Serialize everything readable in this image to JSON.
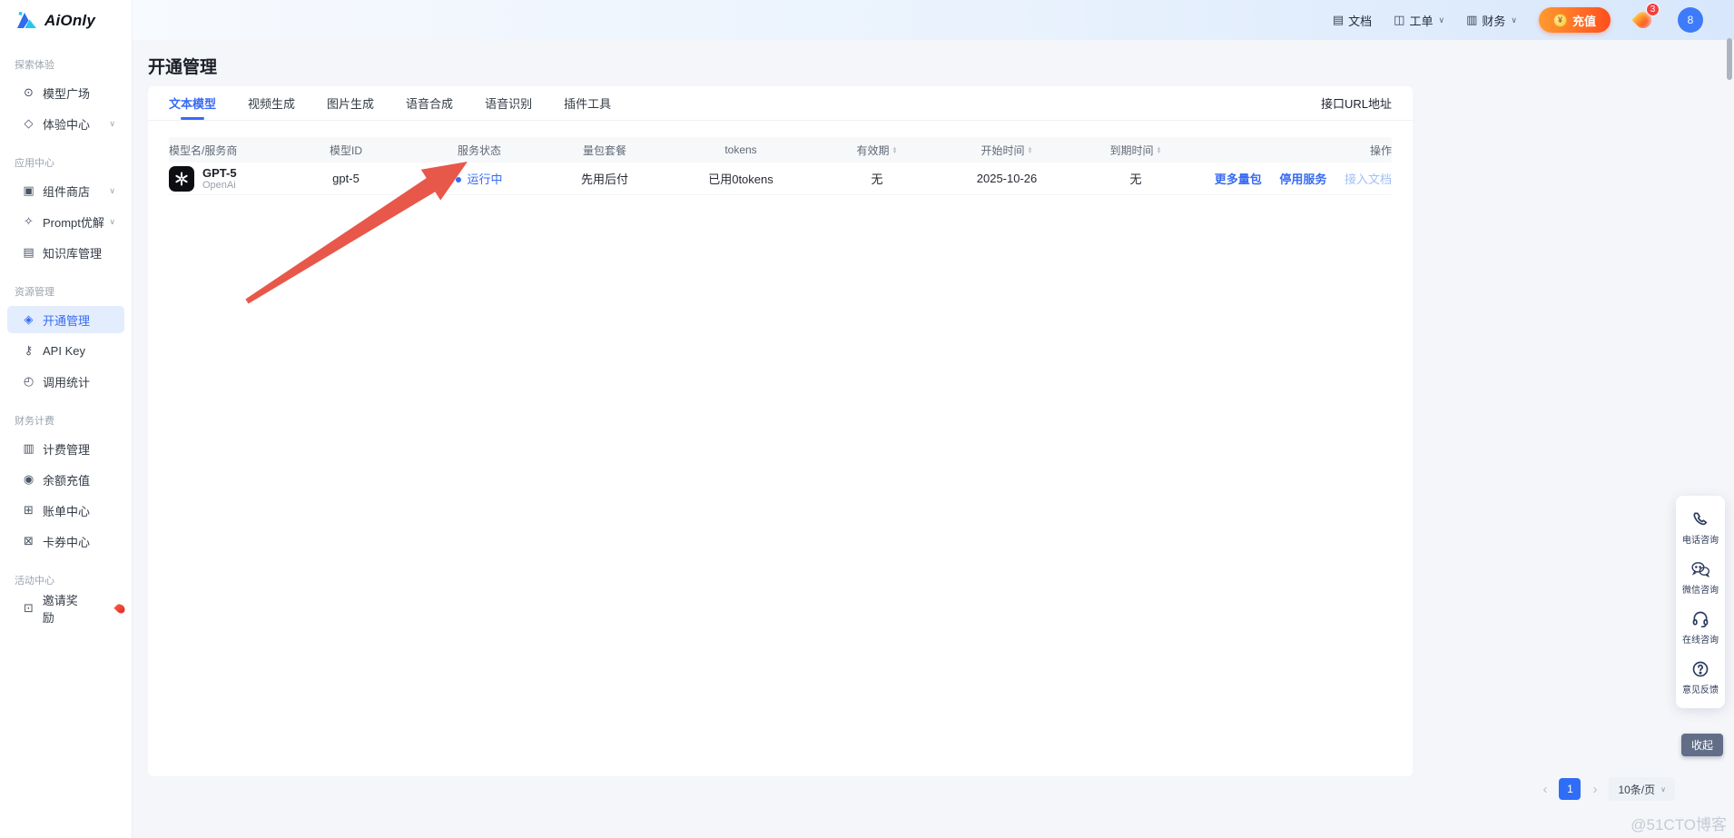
{
  "brand": {
    "name": "AiOnly"
  },
  "icons": {
    "chevron_down": "∨",
    "caret_up": "▲",
    "caret_down": "▼",
    "doc": "▤",
    "ticket": "◫",
    "finance": "▥",
    "coin": "¥",
    "model_plaza": "⊙",
    "experience": "◇",
    "component_store": "▣",
    "prompt": "✧",
    "knowledge": "▤",
    "activation": "◈",
    "api_key": "⚷",
    "stats": "◴",
    "billing": "▥",
    "recharge_balance": "◉",
    "bill_center": "⊞",
    "coupon": "⊠",
    "invite": "⊡",
    "prev": "‹",
    "next": "›"
  },
  "colors": {
    "accent": "#386bf3",
    "status_running": "#386bf3",
    "recharge_gradient_start": "#ff9a30",
    "recharge_gradient_end": "#ff4e1e",
    "fire_badge": "#f53f3f",
    "arrow_red": "#e8584a"
  },
  "topbar": {
    "docs": "文档",
    "tickets": "工单",
    "finance": "财务",
    "recharge": "充值",
    "fire_badge": "3",
    "avatar": "8"
  },
  "sidebar": {
    "sections": [
      {
        "title": "探索体验",
        "items": [
          {
            "label": "模型广场"
          },
          {
            "label": "体验中心"
          }
        ]
      },
      {
        "title": "应用中心",
        "items": [
          {
            "label": "组件商店"
          },
          {
            "label": "Prompt优解"
          },
          {
            "label": "知识库管理"
          }
        ]
      },
      {
        "title": "资源管理",
        "items": [
          {
            "label": "开通管理"
          },
          {
            "label": "API Key"
          },
          {
            "label": "调用统计"
          }
        ]
      },
      {
        "title": "财务计费",
        "items": [
          {
            "label": "计费管理"
          },
          {
            "label": "余额充值"
          },
          {
            "label": "账单中心"
          },
          {
            "label": "卡券中心"
          }
        ]
      },
      {
        "title": "活动中心",
        "items": [
          {
            "label": "邀请奖励"
          }
        ]
      }
    ]
  },
  "page": {
    "title": "开通管理",
    "tabs": [
      {
        "label": "文本模型"
      },
      {
        "label": "视频生成"
      },
      {
        "label": "图片生成"
      },
      {
        "label": "语音合成"
      },
      {
        "label": "语音识别"
      },
      {
        "label": "插件工具"
      }
    ],
    "url_link": "接口URL地址"
  },
  "table": {
    "headers": {
      "model": "模型名/服务商",
      "model_id": "模型ID",
      "status": "服务状态",
      "package": "量包套餐",
      "tokens": "tokens",
      "validity": "有效期",
      "start": "开始时间",
      "expire": "到期时间",
      "actions": "操作"
    },
    "row": {
      "name": "GPT-5",
      "provider": "OpenAi",
      "model_id": "gpt-5",
      "status": "运行中",
      "package": "先用后付",
      "tokens": "已用0tokens",
      "validity": "无",
      "start": "2025-10-26",
      "expire": "无",
      "actions": {
        "more_packages": "更多量包",
        "stop_service": "停用服务",
        "integration_docs": "接入文档"
      }
    }
  },
  "pagination": {
    "page": "1",
    "page_size": "10条/页"
  },
  "float_menu": {
    "phone": "电话咨询",
    "wechat": "微信咨询",
    "online": "在线咨询",
    "feedback": "意见反馈",
    "collapse": "收起"
  },
  "watermark": "@51CTO博客"
}
